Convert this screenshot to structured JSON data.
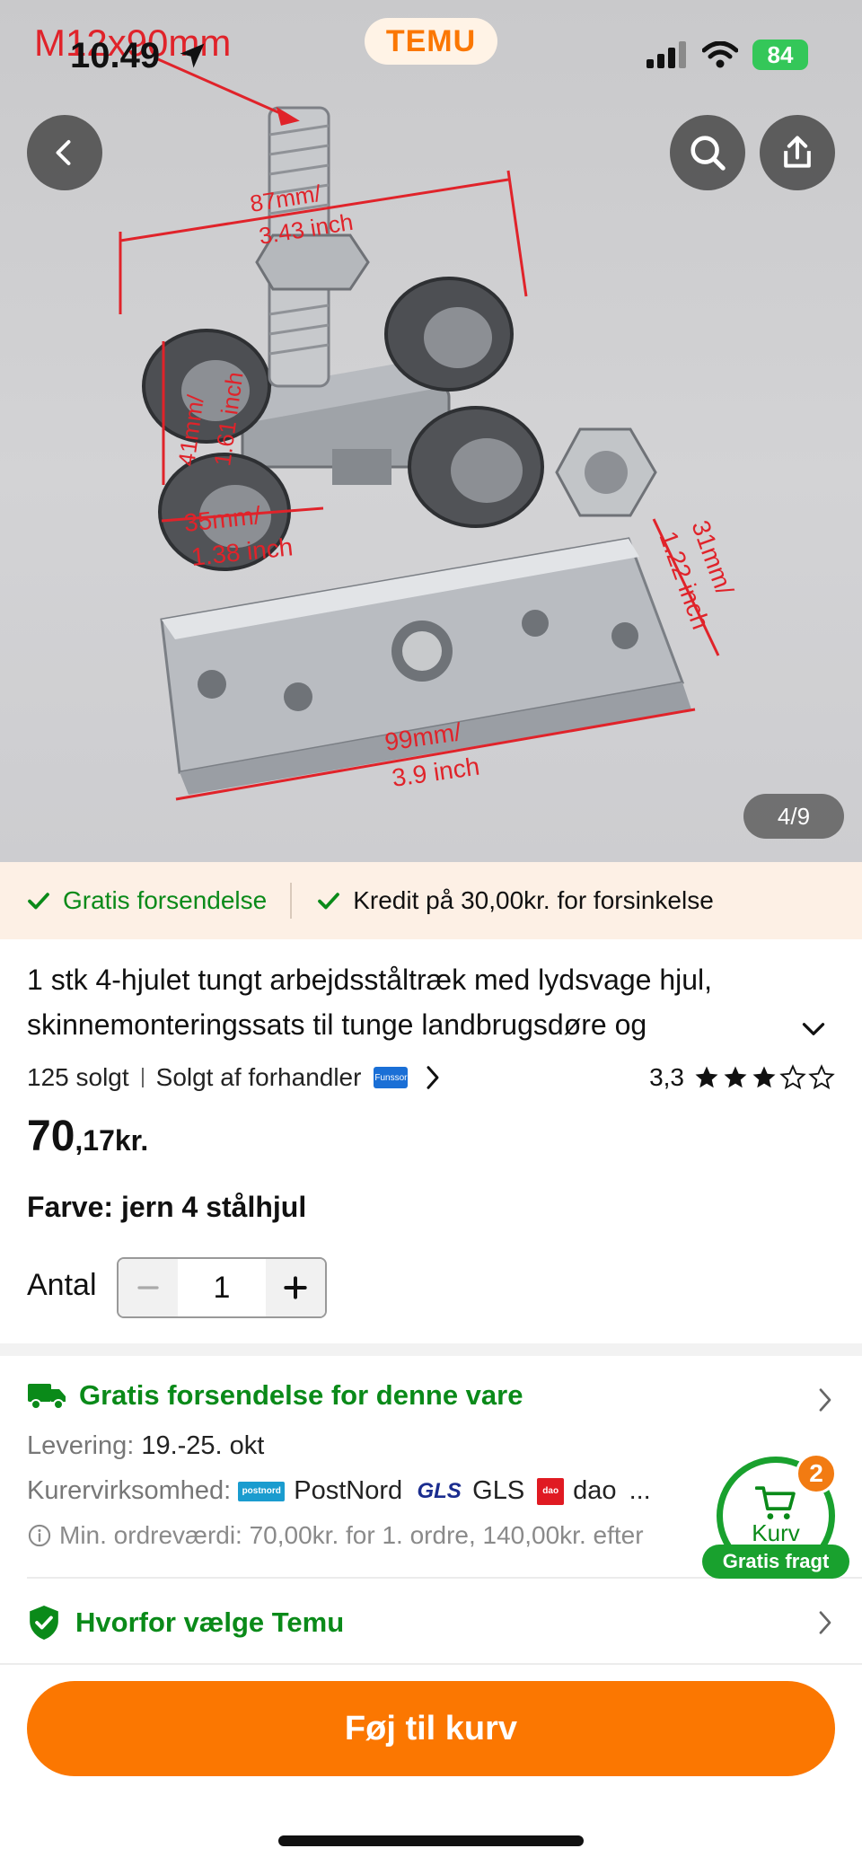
{
  "status_bar": {
    "time": "10.49",
    "battery": "84"
  },
  "hero": {
    "brand": "TEMU",
    "image_counter": "4/9",
    "annotations": {
      "bolt": "M12x90mm",
      "width_mm": "87mm/",
      "width_in": "3.43 inch",
      "height_mm": "41mm/",
      "height_in": "1.61 inch",
      "wheel_mm": "35mm/",
      "wheel_in": "1.38 inch",
      "plate_h_mm": "31mm/",
      "plate_h_in": "1.22 inch",
      "plate_w_mm": "99mm/",
      "plate_w_in": "3.9 inch"
    }
  },
  "benefits": [
    {
      "label": "Gratis forsendelse"
    },
    {
      "label": "Kredit på 30,00kr. for forsinkelse"
    }
  ],
  "product": {
    "title_line1": "1 stk 4-hjulet tungt arbejdsståltræk med lydsvage hjul,",
    "title_line2": "skinnemonteringssats til tunge landbrugsdøre og",
    "sold": "125 solgt",
    "seller": "Solgt af forhandler",
    "seller_logo_text": "Funssor",
    "rating_value": "3,3",
    "rating_stars": 3,
    "price_main": "70",
    "price_rest": ",17kr.",
    "variant": "Farve: jern 4 stålhjul",
    "quantity_label": "Antal",
    "quantity": "1"
  },
  "shipping": {
    "title": "Gratis forsendelse for denne vare",
    "delivery_label": "Levering:",
    "delivery_value": "19.-25. okt",
    "courier_label": "Kurervirksomhed:",
    "courier_postnord_logo": "postnord",
    "courier_1": "PostNord",
    "courier_2_logo": "GLS",
    "courier_2": "GLS",
    "courier_3_logo": "dao",
    "courier_3": "dao",
    "courier_more": "...",
    "min_order": "Min. ordreværdi: 70,00kr. for 1. ordre, 140,00kr. efter"
  },
  "why_temu": "Hvorfor vælge Temu",
  "cart": {
    "label": "Kurv",
    "count": "2",
    "free_shipping": "Gratis fragt"
  },
  "cta": "Føj til kurv",
  "colors": {
    "brand_orange": "#fb7701",
    "green": "#0a8a19",
    "benefit_bg": "#fdf0e5"
  }
}
